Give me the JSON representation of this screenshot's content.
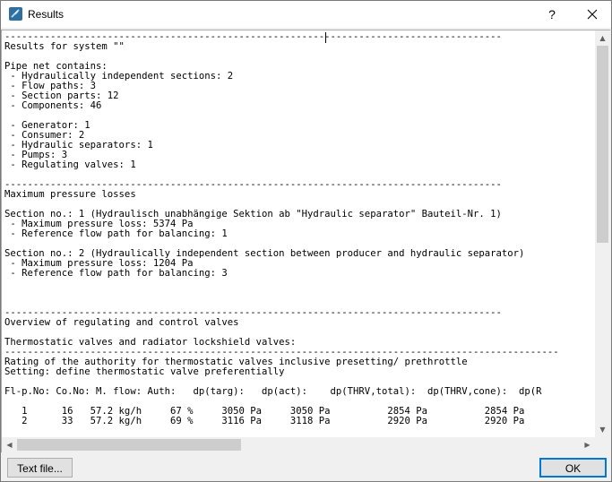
{
  "window": {
    "title": "Results",
    "help_label": "?",
    "close_icon": "close-icon"
  },
  "report": {
    "lines": [
      "---------------------------------------------------------------------------------------",
      "Results for system \"\"",
      "",
      "Pipe net contains:",
      " - Hydraulically independent sections: 2",
      " - Flow paths: 3",
      " - Section parts: 12",
      " - Components: 46",
      "",
      " - Generator: 1",
      " - Consumer: 2",
      " - Hydraulic separators: 1",
      " - Pumps: 3",
      " - Regulating valves: 1",
      "",
      "---------------------------------------------------------------------------------------",
      "Maximum pressure losses",
      "",
      "Section no.: 1 (Hydraulisch unabhängige Sektion ab \"Hydraulic separator\" Bauteil-Nr. 1)",
      " - Maximum pressure loss: 5374 Pa",
      " - Reference flow path for balancing: 1",
      "",
      "Section no.: 2 (Hydraulically independent section between producer and hydraulic separator)",
      " - Maximum pressure loss: 1204 Pa",
      " - Reference flow path for balancing: 3",
      "",
      "",
      "",
      "---------------------------------------------------------------------------------------",
      "Overview of regulating and control valves",
      "",
      "Thermostatic valves and radiator lockshield valves:",
      "-------------------------------------------------------------------------------------------------",
      "Rating of the authority for thermostatic valves inclusive presetting/ prethrottle",
      "Setting: define thermostatic valve preferentially",
      "",
      "Fl-p.No: Co.No: M. flow: Auth:   dp(targ):   dp(act):    dp(THRV,total):  dp(THRV,cone):  dp(R",
      "",
      "   1      16   57.2 kg/h     67 %     3050 Pa     3050 Pa          2854 Pa          2854 Pa",
      "   2      33   57.2 kg/h     69 %     3116 Pa     3118 Pa          2920 Pa          2920 Pa"
    ]
  },
  "scrollbars": {
    "up_arrow": "▲",
    "down_arrow": "▼",
    "left_arrow": "◀",
    "right_arrow": "▶"
  },
  "buttons": {
    "text_file_label": "Text file...",
    "ok_label": "OK"
  }
}
